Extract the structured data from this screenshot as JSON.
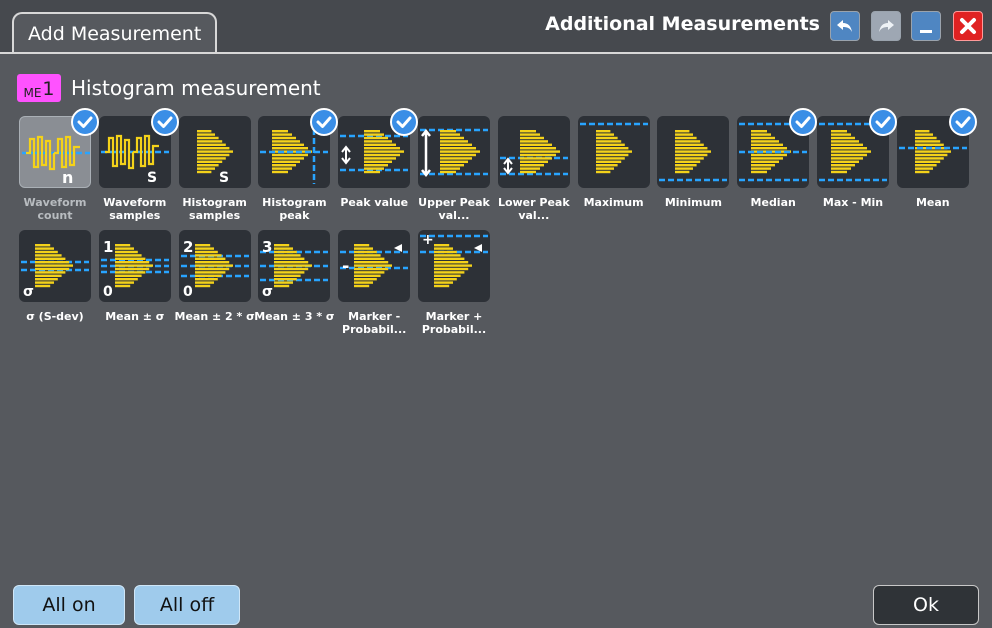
{
  "tab_label": "Add Measurement",
  "dialog_title": "Additional Measurements",
  "header": {
    "badge_prefix": "ME",
    "badge_num": "1",
    "title": "Histogram measurement"
  },
  "tiles": [
    {
      "label": "Waveform count",
      "icon": "waveform-count",
      "checked": true,
      "selected": true,
      "glyph": "n"
    },
    {
      "label": "Waveform samples",
      "icon": "waveform-samples",
      "checked": true,
      "selected": false,
      "glyph": "S"
    },
    {
      "label": "Histogram samples",
      "icon": "histogram-samples",
      "checked": false,
      "selected": false,
      "glyph": "S"
    },
    {
      "label": "Histogram peak",
      "icon": "histogram-peak",
      "checked": true,
      "selected": false,
      "glyph": ""
    },
    {
      "label": "Peak value",
      "icon": "peak-value",
      "checked": true,
      "selected": false,
      "glyph": ""
    },
    {
      "label": "Upper Peak val...",
      "icon": "upper-peak-value",
      "checked": false,
      "selected": false,
      "glyph": ""
    },
    {
      "label": "Lower Peak val...",
      "icon": "lower-peak-value",
      "checked": false,
      "selected": false,
      "glyph": ""
    },
    {
      "label": "Maximum",
      "icon": "maximum",
      "checked": false,
      "selected": false,
      "glyph": ""
    },
    {
      "label": "Minimum",
      "icon": "minimum",
      "checked": false,
      "selected": false,
      "glyph": ""
    },
    {
      "label": "Median",
      "icon": "median",
      "checked": true,
      "selected": false,
      "glyph": ""
    },
    {
      "label": "Max - Min",
      "icon": "max-min",
      "checked": true,
      "selected": false,
      "glyph": ""
    },
    {
      "label": "Mean",
      "icon": "mean",
      "checked": true,
      "selected": false,
      "glyph": ""
    },
    {
      "label": "σ (S-dev)",
      "icon": "sigma-sdev",
      "checked": false,
      "selected": false,
      "glyph": "σ"
    },
    {
      "label": "Mean ± σ",
      "icon": "mean-pm-sigma",
      "checked": false,
      "selected": false,
      "glyph": "1σ"
    },
    {
      "label": "Mean ± 2 * σ",
      "icon": "mean-pm-2sigma",
      "checked": false,
      "selected": false,
      "glyph": "2σ"
    },
    {
      "label": "Mean ± 3 * σ",
      "icon": "mean-pm-3sigma",
      "checked": false,
      "selected": false,
      "glyph": "3σ"
    },
    {
      "label": "Marker - Probabil...",
      "icon": "marker-minus-probability",
      "checked": false,
      "selected": false,
      "glyph": "-"
    },
    {
      "label": "Marker + Probabil...",
      "icon": "marker-plus-probability",
      "checked": false,
      "selected": false,
      "glyph": "+"
    }
  ],
  "buttons": {
    "all_on": "All on",
    "all_off": "All off",
    "ok": "Ok"
  },
  "colors": {
    "accent_yellow": "#f4d21a",
    "dash_blue": "#28a4ff",
    "check_blue": "#3a8ee6",
    "badge_magenta": "#ff52ff",
    "close_red": "#e02222"
  }
}
